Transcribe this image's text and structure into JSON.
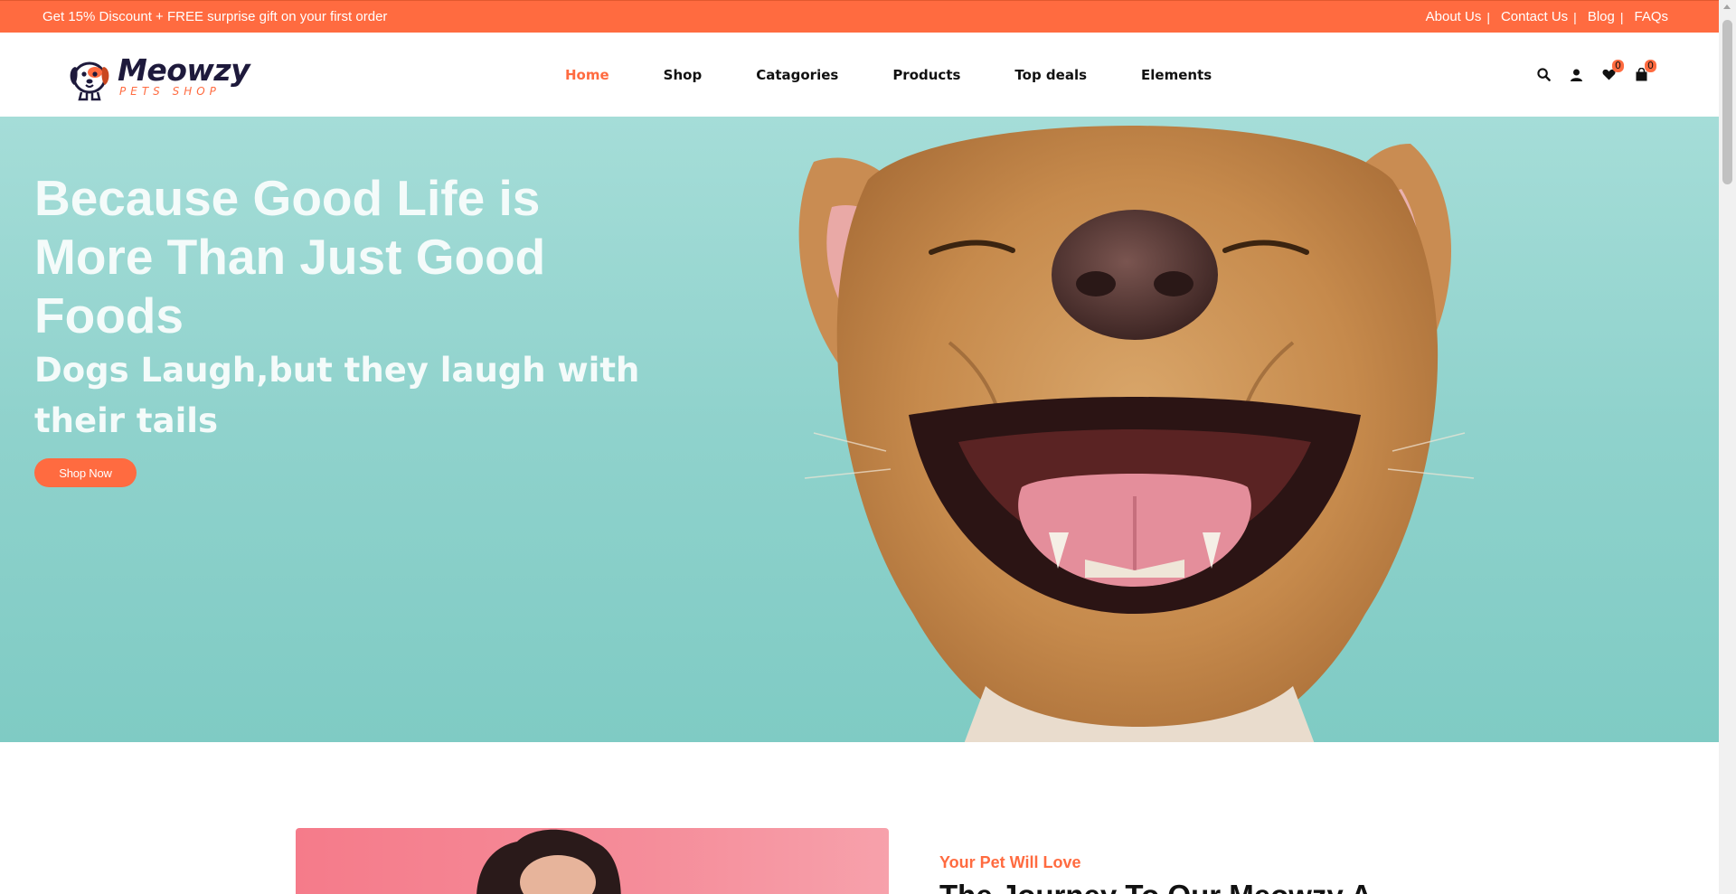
{
  "topbar": {
    "promo": "Get 15% Discount + FREE surprise gift on your first order",
    "links": [
      {
        "label": "About Us",
        "sep": "|"
      },
      {
        "label": "Contact Us",
        "sep": "|"
      },
      {
        "label": "Blog",
        "sep": "|"
      },
      {
        "label": "FAQs",
        "sep": ""
      }
    ],
    "color": "#ff6b40"
  },
  "header": {
    "logo": {
      "name": "Meowzy",
      "sub": "PETS SHOP"
    },
    "nav": [
      {
        "label": "Home",
        "active": true
      },
      {
        "label": "Shop",
        "active": false
      },
      {
        "label": "Catagories",
        "active": false
      },
      {
        "label": "Products",
        "active": false
      },
      {
        "label": "Top deals",
        "active": false
      },
      {
        "label": "Elements",
        "active": false
      }
    ],
    "tools": {
      "search_icon": "search-icon",
      "account_icon": "user-icon",
      "wishlist_icon": "heart-icon",
      "wishlist_count": "0",
      "cart_icon": "shopping-bag-icon",
      "cart_count": "0"
    }
  },
  "hero": {
    "title": "Because Good Life is More Than Just Good Foods",
    "subtitle": "Dogs Laugh,but they laugh with their tails",
    "cta": "Shop Now",
    "bg_color": "#8fd2cc"
  },
  "about": {
    "eyebrow": "Your Pet Will Love",
    "title": "The Journey To Our Meowzy A"
  }
}
